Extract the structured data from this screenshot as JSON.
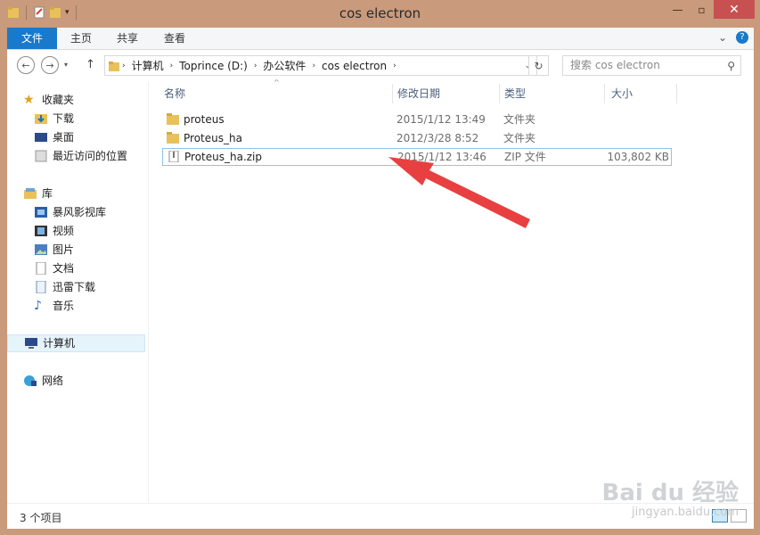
{
  "window": {
    "title": "cos electron"
  },
  "ribbon": {
    "tabs": [
      "文件",
      "主页",
      "共享",
      "查看"
    ]
  },
  "address": {
    "crumbs": [
      "计算机",
      "Toprince (D:)",
      "办公软件",
      "cos electron"
    ],
    "search_placeholder": "搜索 cos electron"
  },
  "nav": {
    "favorites": {
      "label": "收藏夹",
      "items": [
        "下载",
        "桌面",
        "最近访问的位置"
      ]
    },
    "libraries": {
      "label": "库",
      "items": [
        "暴风影视库",
        "视频",
        "图片",
        "文档",
        "迅雷下载",
        "音乐"
      ]
    },
    "computer": "计算机",
    "network": "网络"
  },
  "columns": {
    "name": "名称",
    "date": "修改日期",
    "type": "类型",
    "size": "大小"
  },
  "files": [
    {
      "name": "proteus",
      "date": "2015/1/12 13:49",
      "type": "文件夹",
      "size": ""
    },
    {
      "name": "Proteus_ha",
      "date": "2012/3/28 8:52",
      "type": "文件夹",
      "size": ""
    },
    {
      "name": "Proteus_ha.zip",
      "date": "2015/1/12 13:46",
      "type": "ZIP 文件",
      "size": "103,802 KB"
    }
  ],
  "status": {
    "count": "3 个项目"
  },
  "watermark": {
    "brand": "Bai du 经验",
    "url": "jingyan.baidu.com"
  },
  "colors": {
    "accent": "#1979ca",
    "frame": "#c99a7b",
    "arrow": "#e84040",
    "close": "#c75050"
  },
  "icons": [
    "folder-icon",
    "doc-icon",
    "back-icon",
    "forward-icon",
    "up-icon",
    "refresh-icon",
    "search-icon",
    "star-icon",
    "library-icon",
    "computer-icon",
    "network-icon",
    "zip-file-icon"
  ]
}
